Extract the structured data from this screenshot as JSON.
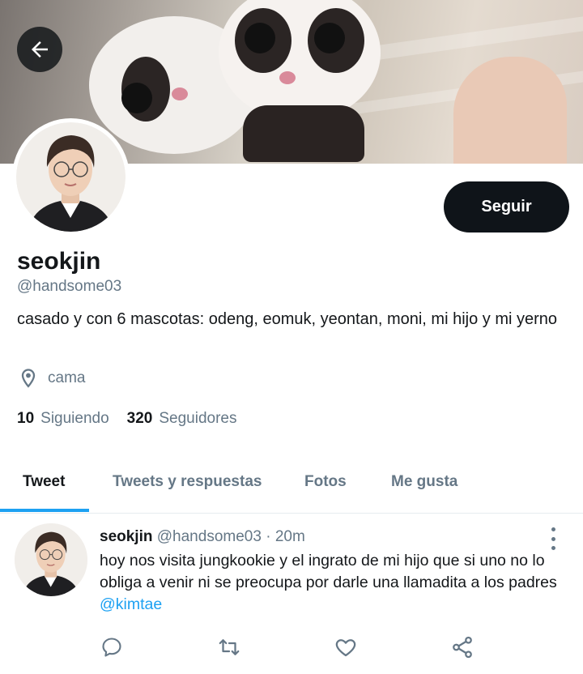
{
  "header": {
    "back_icon": "arrow-left-icon",
    "banner_description_colors": {
      "hand": "#e9c9b6",
      "fur": "#f2efec"
    }
  },
  "profile": {
    "name": "seokjin",
    "handle": "@handsome03",
    "bio": "casado y con 6 mascotas: odeng, eomuk, yeontan, moni, mi hijo y mi yerno",
    "location": "cama",
    "location_icon": "map-pin-icon",
    "follow_label": "Seguir",
    "following_count": "10",
    "following_label": "Siguiendo",
    "followers_count": "320",
    "followers_label": "Seguidores"
  },
  "tabs": [
    {
      "label": "Tweet",
      "active": true
    },
    {
      "label": "Tweets y respuestas",
      "active": false
    },
    {
      "label": "Fotos",
      "active": false
    },
    {
      "label": "Me gusta",
      "active": false
    }
  ],
  "tweet": {
    "name": "seokjin",
    "handle": "@handsome03",
    "separator": " · ",
    "time": "20m",
    "text": "hoy nos visita jungkookie y el ingrato de mi hijo que si uno no lo obliga a venir ni se preocupa por darle una llamadita a los padres ",
    "mention": "@kimtae",
    "actions": [
      "reply-icon",
      "retweet-icon",
      "like-icon",
      "share-icon"
    ]
  },
  "colors": {
    "accent": "#1da1f2",
    "text_primary": "#14171a",
    "text_secondary": "#657786",
    "button_bg": "#0f1419"
  }
}
